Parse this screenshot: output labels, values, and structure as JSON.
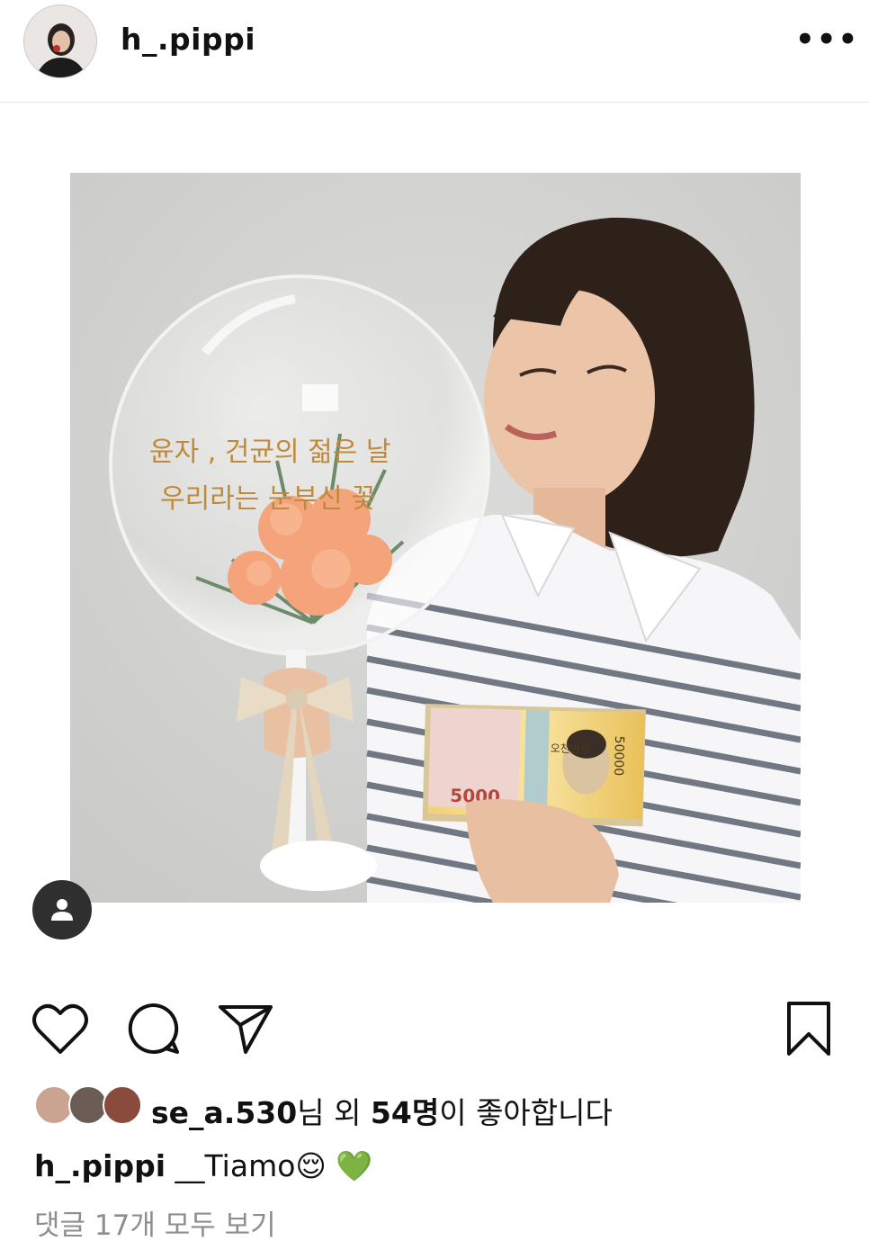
{
  "header": {
    "username": "h_.pippi",
    "more_label": "•••"
  },
  "tag_icon": "person-icon",
  "actions": {
    "like_icon": "heart-icon",
    "comment_icon": "comment-icon",
    "share_icon": "send-icon",
    "save_icon": "bookmark-icon"
  },
  "likes": {
    "liker_name": "se_a.530",
    "text_after_name": "님 외 ",
    "count": "54명",
    "text_end": "이 좋아합니다"
  },
  "caption": {
    "username": "h_.pippi",
    "text": "__Tiamo😌 💚"
  },
  "comments": {
    "view_all": "댓글 17개 모두 보기"
  },
  "photo": {
    "balloon_text_line1": "윤자 , 건균의 젊은 날",
    "balloon_text_line2": "우리라는 눈부신 꽃",
    "banknote_value": "50000",
    "banknote_small": "5000",
    "banknote_label": "오천만원"
  },
  "colors": {
    "text": "#111111",
    "muted": "#8e8e8e",
    "divider": "#e6e6e6",
    "tag_bg": "#2f2f2f"
  }
}
